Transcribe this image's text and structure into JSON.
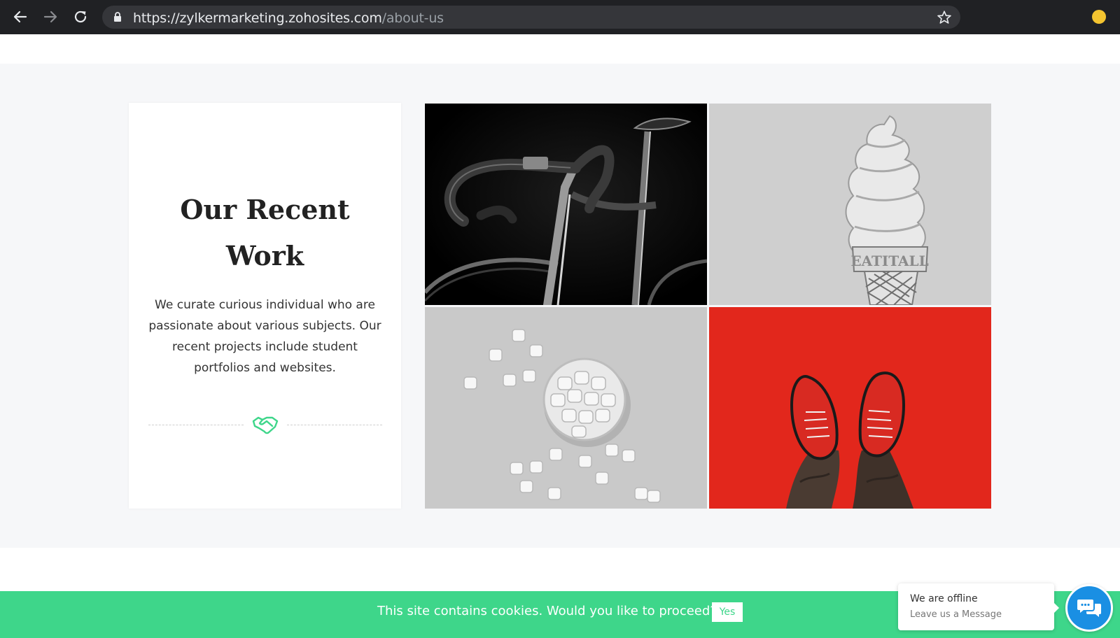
{
  "browser": {
    "url_host": "https://zylkermarketing.zohosites.com",
    "url_path": "/about-us",
    "icons": [
      "back-arrow-icon",
      "forward-arrow-icon",
      "reload-icon",
      "lock-icon",
      "star-icon",
      "extension-icon"
    ]
  },
  "card": {
    "title": "Our Recent Work",
    "description": "We curate curious individual who are passionate about various subjects. Our recent projects include student portfolios and websites.",
    "divider_icon": "handshake-icon",
    "accent_color": "#3ed68a"
  },
  "gallery": {
    "images": [
      "bicycle-photo",
      "ice-cream-sign-photo",
      "marshmallows-photo",
      "red-sneakers-photo"
    ],
    "sign_text": "EATITALL"
  },
  "cookie": {
    "message": "This site contains cookies. Would you like to proceed?",
    "yes_label": "Yes",
    "bar_color": "#3ed68a"
  },
  "chat": {
    "status": "We are offline",
    "subtitle": "Leave us a Message",
    "button_color": "#1a8fe3",
    "icon": "chat-bubbles-icon"
  }
}
